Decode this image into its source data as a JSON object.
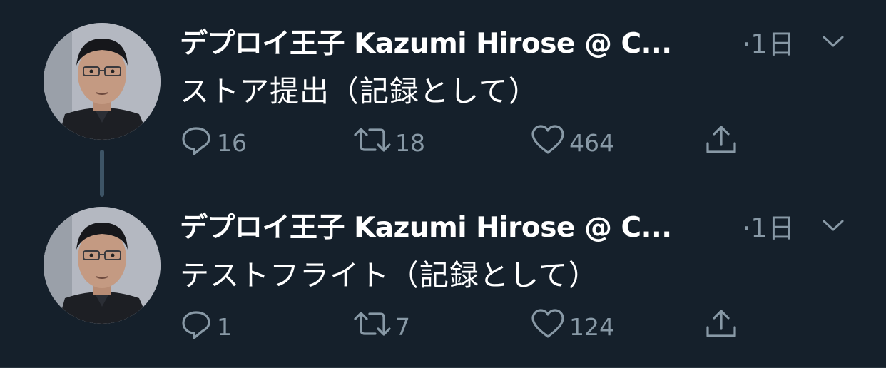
{
  "tweets": [
    {
      "author": "デプロイ王子 Kazumi Hirose @ C...",
      "time": "·1日",
      "text": "ストア提出（記録として）",
      "reply_count": "16",
      "retweet_count": "18",
      "like_count": "464"
    },
    {
      "author": "デプロイ王子 Kazumi Hirose @ C...",
      "time": "·1日",
      "text": "テストフライト（記録として）",
      "reply_count": "1",
      "retweet_count": "7",
      "like_count": "124"
    }
  ],
  "icons": {
    "reply": "speech-bubble-icon",
    "retweet": "retweet-arrows-icon",
    "like": "heart-outline-icon",
    "share": "share-upload-icon",
    "more": "chevron-down-icon"
  },
  "colors": {
    "background": "#15202b",
    "primary_text": "#ffffff",
    "secondary_text": "#8899a6",
    "thread_line": "#3d5466"
  }
}
